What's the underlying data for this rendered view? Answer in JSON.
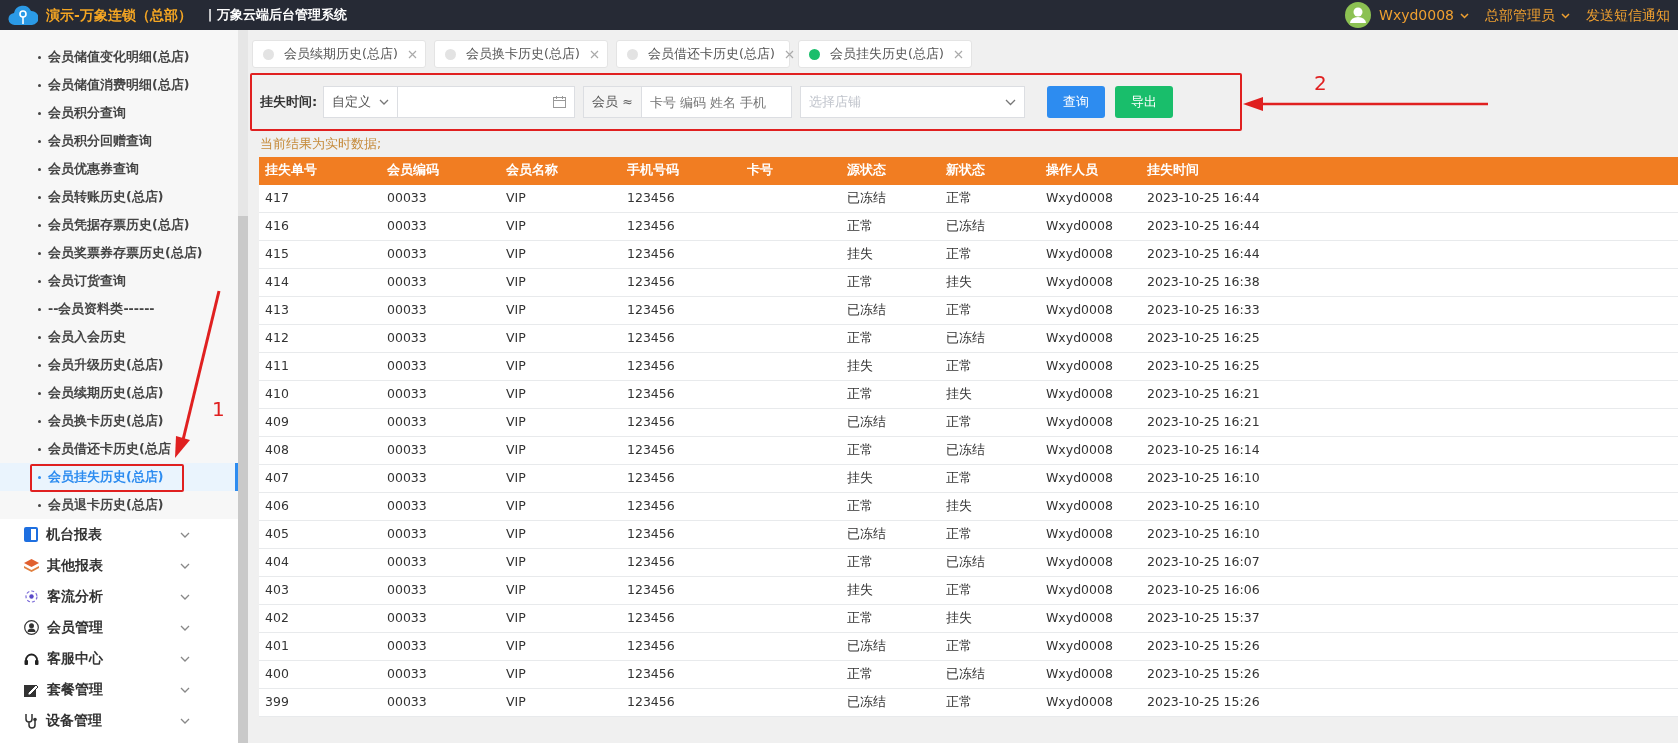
{
  "header": {
    "brand": "演示-万象连锁（总部）",
    "system": "| 万象云端后台管理系统",
    "user": "Wxyd0008",
    "role": "总部管理员",
    "notify": "发送短信通知"
  },
  "sidebar": {
    "sub_items": [
      {
        "label": "会员储值变化明细(总店)",
        "selected": false
      },
      {
        "label": "会员储值消费明细(总店)",
        "selected": false
      },
      {
        "label": "会员积分查询",
        "selected": false
      },
      {
        "label": "会员积分回赠查询",
        "selected": false
      },
      {
        "label": "会员优惠券查询",
        "selected": false
      },
      {
        "label": "会员转账历史(总店)",
        "selected": false
      },
      {
        "label": "会员凭据存票历史(总店)",
        "selected": false
      },
      {
        "label": "会员奖票券存票历史(总店)",
        "selected": false
      },
      {
        "label": "会员订货查询",
        "selected": false
      },
      {
        "label": "--会员资料类------",
        "selected": false
      },
      {
        "label": "会员入会历史",
        "selected": false
      },
      {
        "label": "会员升级历史(总店)",
        "selected": false
      },
      {
        "label": "会员续期历史(总店)",
        "selected": false
      },
      {
        "label": "会员换卡历史(总店)",
        "selected": false
      },
      {
        "label": "会员借还卡历史(总店",
        "selected": false
      },
      {
        "label": "会员挂失历史(总店)",
        "selected": true
      },
      {
        "label": "会员退卡历史(总店)",
        "selected": false
      }
    ],
    "menus": [
      {
        "label": "机台报表",
        "kind": "book",
        "expanded": false
      },
      {
        "label": "其他报表",
        "kind": "layers",
        "expanded": false
      },
      {
        "label": "客流分析",
        "kind": "target",
        "expanded": false
      },
      {
        "label": "会员管理",
        "kind": "person",
        "expanded": false
      },
      {
        "label": "客服中心",
        "kind": "headset",
        "expanded": false
      },
      {
        "label": "套餐管理",
        "kind": "edit",
        "expanded": false
      },
      {
        "label": "设备管理",
        "kind": "stethoscope",
        "expanded": false
      }
    ]
  },
  "tabs": [
    {
      "label": "会员续期历史(总店)",
      "selected": false
    },
    {
      "label": "会员换卡历史(总店)",
      "selected": false
    },
    {
      "label": "会员借还卡历史(总店)",
      "selected": false
    },
    {
      "label": "会员挂失历史(总店)",
      "selected": true
    }
  ],
  "filter": {
    "time_label": "挂失时间:",
    "range_select": "自定义",
    "member_addon": "会员 ≈",
    "member_placeholder": "卡号 编码 姓名 手机",
    "store_placeholder": "选择店铺",
    "query_button": "查询",
    "export_button": "导出"
  },
  "notice": "当前结果为实时数据;",
  "table": {
    "columns": [
      "挂失单号",
      "会员编码",
      "会员名称",
      "手机号码",
      "卡号",
      "源状态",
      "新状态",
      "操作人员",
      "挂失时间"
    ],
    "rows": [
      {
        "no": "417",
        "code": "00033",
        "name": "VIP",
        "phone": "123456",
        "from": "已冻结",
        "to": "正常",
        "operator": "Wxyd0008",
        "time": "2023-10-25 16:44"
      },
      {
        "no": "416",
        "code": "00033",
        "name": "VIP",
        "phone": "123456",
        "from": "正常",
        "to": "已冻结",
        "operator": "Wxyd0008",
        "time": "2023-10-25 16:44"
      },
      {
        "no": "415",
        "code": "00033",
        "name": "VIP",
        "phone": "123456",
        "from": "挂失",
        "to": "正常",
        "operator": "Wxyd0008",
        "time": "2023-10-25 16:44"
      },
      {
        "no": "414",
        "code": "00033",
        "name": "VIP",
        "phone": "123456",
        "from": "正常",
        "to": "挂失",
        "operator": "Wxyd0008",
        "time": "2023-10-25 16:38"
      },
      {
        "no": "413",
        "code": "00033",
        "name": "VIP",
        "phone": "123456",
        "from": "已冻结",
        "to": "正常",
        "operator": "Wxyd0008",
        "time": "2023-10-25 16:33"
      },
      {
        "no": "412",
        "code": "00033",
        "name": "VIP",
        "phone": "123456",
        "from": "正常",
        "to": "已冻结",
        "operator": "Wxyd0008",
        "time": "2023-10-25 16:25"
      },
      {
        "no": "411",
        "code": "00033",
        "name": "VIP",
        "phone": "123456",
        "from": "挂失",
        "to": "正常",
        "operator": "Wxyd0008",
        "time": "2023-10-25 16:25"
      },
      {
        "no": "410",
        "code": "00033",
        "name": "VIP",
        "phone": "123456",
        "from": "正常",
        "to": "挂失",
        "operator": "Wxyd0008",
        "time": "2023-10-25 16:21"
      },
      {
        "no": "409",
        "code": "00033",
        "name": "VIP",
        "phone": "123456",
        "from": "已冻结",
        "to": "正常",
        "operator": "Wxyd0008",
        "time": "2023-10-25 16:21"
      },
      {
        "no": "408",
        "code": "00033",
        "name": "VIP",
        "phone": "123456",
        "from": "正常",
        "to": "已冻结",
        "operator": "Wxyd0008",
        "time": "2023-10-25 16:14"
      },
      {
        "no": "407",
        "code": "00033",
        "name": "VIP",
        "phone": "123456",
        "from": "挂失",
        "to": "正常",
        "operator": "Wxyd0008",
        "time": "2023-10-25 16:10"
      },
      {
        "no": "406",
        "code": "00033",
        "name": "VIP",
        "phone": "123456",
        "from": "正常",
        "to": "挂失",
        "operator": "Wxyd0008",
        "time": "2023-10-25 16:10"
      },
      {
        "no": "405",
        "code": "00033",
        "name": "VIP",
        "phone": "123456",
        "from": "已冻结",
        "to": "正常",
        "operator": "Wxyd0008",
        "time": "2023-10-25 16:10"
      },
      {
        "no": "404",
        "code": "00033",
        "name": "VIP",
        "phone": "123456",
        "from": "正常",
        "to": "已冻结",
        "operator": "Wxyd0008",
        "time": "2023-10-25 16:07"
      },
      {
        "no": "403",
        "code": "00033",
        "name": "VIP",
        "phone": "123456",
        "from": "挂失",
        "to": "正常",
        "operator": "Wxyd0008",
        "time": "2023-10-25 16:06"
      },
      {
        "no": "402",
        "code": "00033",
        "name": "VIP",
        "phone": "123456",
        "from": "正常",
        "to": "挂失",
        "operator": "Wxyd0008",
        "time": "2023-10-25 15:37"
      },
      {
        "no": "401",
        "code": "00033",
        "name": "VIP",
        "phone": "123456",
        "from": "已冻结",
        "to": "正常",
        "operator": "Wxyd0008",
        "time": "2023-10-25 15:26"
      },
      {
        "no": "400",
        "code": "00033",
        "name": "VIP",
        "phone": "123456",
        "from": "正常",
        "to": "已冻结",
        "operator": "Wxyd0008",
        "time": "2023-10-25 15:26"
      },
      {
        "no": "399",
        "code": "00033",
        "name": "VIP",
        "phone": "123456",
        "from": "已冻结",
        "to": "正常",
        "operator": "Wxyd0008",
        "time": "2023-10-25 15:26"
      }
    ]
  },
  "annotations": [
    {
      "label": "1"
    },
    {
      "label": "2"
    }
  ]
}
